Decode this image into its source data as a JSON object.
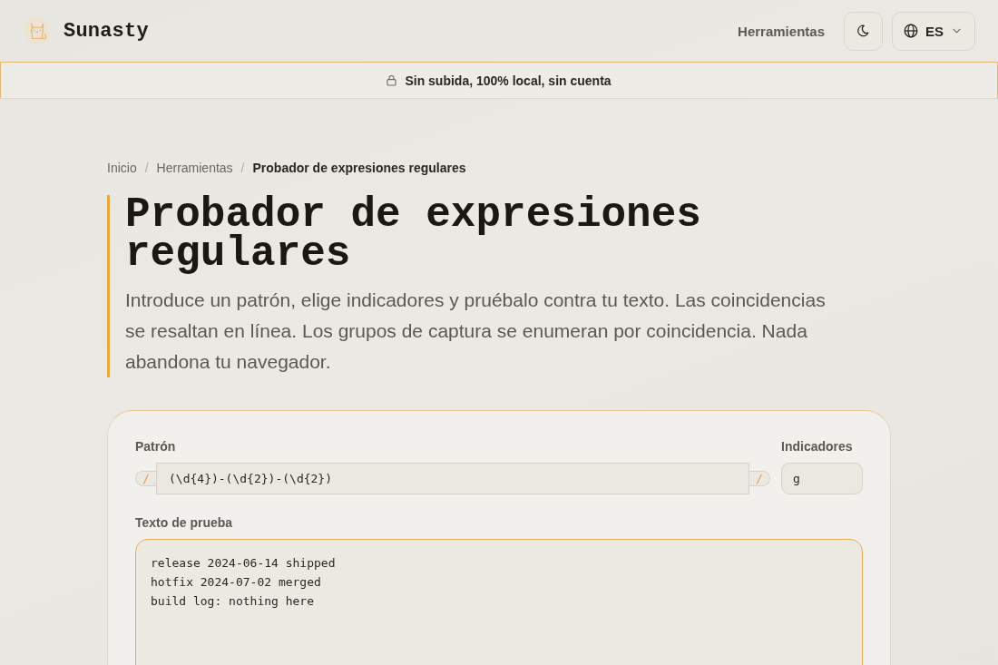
{
  "header": {
    "brand": "Sunasty",
    "nav": [
      {
        "label": "Herramientas"
      }
    ],
    "language": "ES"
  },
  "banner": {
    "text": "Sin subida, 100% local, sin cuenta"
  },
  "breadcrumb": {
    "items": [
      {
        "label": "Inicio",
        "current": false
      },
      {
        "label": "Herramientas",
        "current": false
      },
      {
        "label": "Probador de expresiones regulares",
        "current": true
      }
    ],
    "separators": [
      "/",
      "/"
    ]
  },
  "page": {
    "title": "Probador de expresiones regulares",
    "description": "Introduce un patrón, elige indicadores y pruébalo contra tu texto. Las coincidencias se resaltan en línea. Los grupos de captura se enumeran por coincidencia. Nada abandona tu navegador."
  },
  "tool": {
    "pattern": {
      "label": "Patrón",
      "delimiters": [
        "/",
        "/"
      ],
      "value": "(\\d{4})-(\\d{2})-(\\d{2})"
    },
    "flags": {
      "label": "Indicadores",
      "value": "g"
    },
    "test_text": {
      "label": "Texto de prueba",
      "value": "release 2024-06-14 shipped\nhotfix 2024-07-02 merged\nbuild log: nothing here",
      "focused": true
    }
  }
}
